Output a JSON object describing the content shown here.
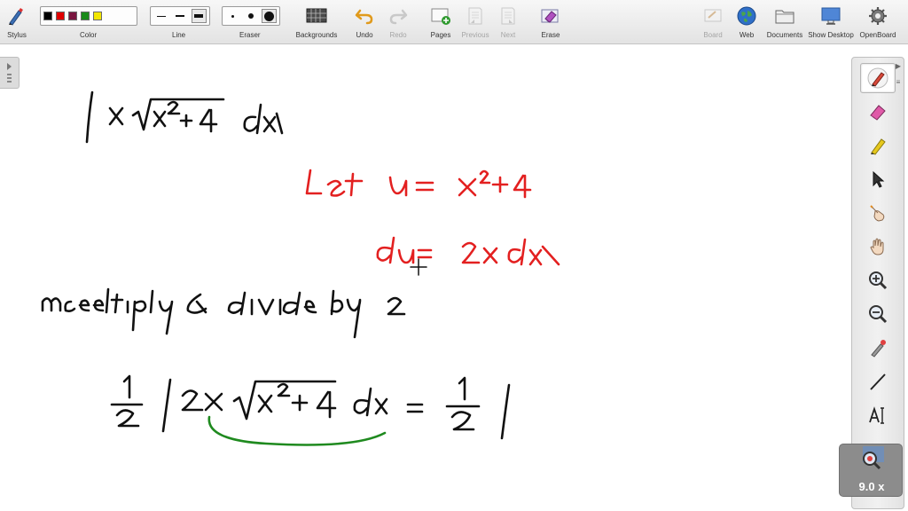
{
  "toolbar": {
    "stylus_label": "Stylus",
    "color_label": "Color",
    "line_label": "Line",
    "eraser_label": "Eraser",
    "backgrounds_label": "Backgrounds",
    "undo_label": "Undo",
    "redo_label": "Redo",
    "pages_label": "Pages",
    "previous_label": "Previous",
    "next_label": "Next",
    "erase_label": "Erase",
    "board_label": "Board",
    "web_label": "Web",
    "documents_label": "Documents",
    "show_desktop_label": "Show Desktop",
    "openboard_label": "OpenBoard"
  },
  "colors": {
    "swatches": [
      "#000000",
      "#e00000",
      "#7a1740",
      "#1a8a1a",
      "#f2e600"
    ],
    "ink_black": "#111111",
    "ink_red": "#e32020",
    "ink_green": "#1f8a1f"
  },
  "zoom": {
    "value": "9.0 x"
  }
}
